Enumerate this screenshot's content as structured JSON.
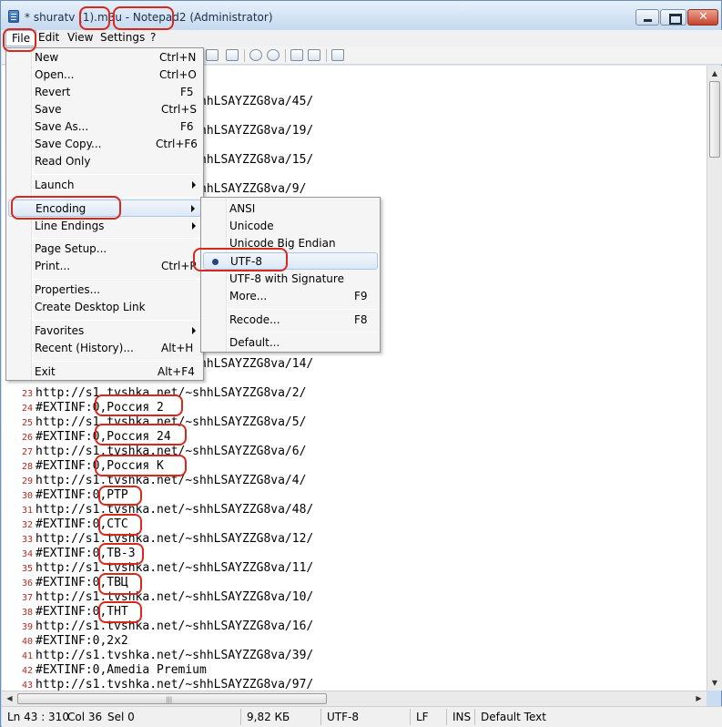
{
  "window": {
    "title": "* shuratv (1).m3u - Notepad2 (Administrator)",
    "accent_color": "#d8281c"
  },
  "menubar": {
    "items": [
      "File",
      "Edit",
      "View",
      "Settings",
      "?"
    ]
  },
  "toolbar": {
    "icons": [
      "new-file-icon",
      "open-icon",
      "save-icon",
      "undo-icon",
      "redo-icon",
      "cut-icon",
      "copy-icon",
      "paste-icon",
      "find-icon",
      "replace-icon",
      "wordwrap-icon",
      "zoom-in-icon",
      "zoom-out-icon",
      "scheme-icon",
      "customize-icon",
      "exit-icon"
    ]
  },
  "file_menu": {
    "items": [
      {
        "label": "New",
        "shortcut": "Ctrl+N"
      },
      {
        "label": "Open...",
        "shortcut": "Ctrl+O"
      },
      {
        "label": "Revert",
        "shortcut": "F5"
      },
      {
        "label": "Save",
        "shortcut": "Ctrl+S"
      },
      {
        "label": "Save As...",
        "shortcut": "F6"
      },
      {
        "label": "Save Copy...",
        "shortcut": "Ctrl+F6"
      },
      {
        "label": "Read Only",
        "shortcut": ""
      },
      {
        "label": "Launch",
        "shortcut": ""
      },
      {
        "label": "Encoding",
        "shortcut": ""
      },
      {
        "label": "Line Endings",
        "shortcut": ""
      },
      {
        "label": "Page Setup...",
        "shortcut": ""
      },
      {
        "label": "Print...",
        "shortcut": "Ctrl+P"
      },
      {
        "label": "Properties...",
        "shortcut": ""
      },
      {
        "label": "Create Desktop Link",
        "shortcut": ""
      },
      {
        "label": "Favorites",
        "shortcut": ""
      },
      {
        "label": "Recent (History)...",
        "shortcut": "Alt+H"
      },
      {
        "label": "Exit",
        "shortcut": "Alt+F4"
      }
    ]
  },
  "encoding_menu": {
    "items": [
      {
        "label": "ANSI",
        "shortcut": ""
      },
      {
        "label": "Unicode",
        "shortcut": ""
      },
      {
        "label": "Unicode Big Endian",
        "shortcut": ""
      },
      {
        "label": "UTF-8",
        "shortcut": "",
        "selected": true
      },
      {
        "label": "UTF-8 with Signature",
        "shortcut": ""
      },
      {
        "label": "More...",
        "shortcut": "F9"
      },
      {
        "label": "Recode...",
        "shortcut": "F8"
      },
      {
        "label": "Default...",
        "shortcut": ""
      }
    ]
  },
  "editor": {
    "lines": [
      {
        "n": "",
        "text": "http://s1.tvshka.net/~shhLSAYZZG8va/45/"
      },
      {
        "n": "",
        "text": "http://s1.tvshka.net/~shhLSAYZZG8va/19/"
      },
      {
        "n": "",
        "text": "http://s1.tvshka.net/~shhLSAYZZG8va/15/"
      },
      {
        "n": "",
        "text": "http://s1.tvshka.net/~shhLSAYZZG8va/9/"
      },
      {
        "n": "",
        "text": "http://s1.tvshka.net/~shhLSAYZZG8va/14/"
      },
      {
        "n": "23",
        "text": "http://s1.tvshka.net/~shhLSAYZZG8va/2/"
      },
      {
        "n": "24",
        "text": "#EXTINF:0,Россия 2"
      },
      {
        "n": "25",
        "text": "http://s1.tvshka.net/~shhLSAYZZG8va/5/"
      },
      {
        "n": "26",
        "text": "#EXTINF:0,Россия 24"
      },
      {
        "n": "27",
        "text": "http://s1.tvshka.net/~shhLSAYZZG8va/6/"
      },
      {
        "n": "28",
        "text": "#EXTINF:0,Россия К"
      },
      {
        "n": "29",
        "text": "http://s1.tvshka.net/~shhLSAYZZG8va/4/"
      },
      {
        "n": "30",
        "text": "#EXTINF:0,РТР"
      },
      {
        "n": "31",
        "text": "http://s1.tvshka.net/~shhLSAYZZG8va/48/"
      },
      {
        "n": "32",
        "text": "#EXTINF:0,СТС"
      },
      {
        "n": "33",
        "text": "http://s1.tvshka.net/~shhLSAYZZG8va/12/"
      },
      {
        "n": "34",
        "text": "#EXTINF:0,ТВ-3"
      },
      {
        "n": "35",
        "text": "http://s1.tvshka.net/~shhLSAYZZG8va/11/"
      },
      {
        "n": "36",
        "text": "#EXTINF:0,ТВЦ"
      },
      {
        "n": "37",
        "text": "http://s1.tvshka.net/~shhLSAYZZG8va/10/"
      },
      {
        "n": "38",
        "text": "#EXTINF:0,ТНТ"
      },
      {
        "n": "39",
        "text": "http://s1.tvshka.net/~shhLSAYZZG8va/16/"
      },
      {
        "n": "40",
        "text": "#EXTINF:0,2x2"
      },
      {
        "n": "41",
        "text": "http://s1.tvshka.net/~shhLSAYZZG8va/39/"
      },
      {
        "n": "42",
        "text": "#EXTINF:0,Amedia Premium"
      },
      {
        "n": "43",
        "text": "http://s1.tvshka.net/~shhLSAYZZG8va/97/"
      }
    ]
  },
  "statusbar": {
    "position": "Ln 43 : 310",
    "column": "Col 36",
    "selection": "Sel 0",
    "size": "9,82 КБ",
    "encoding": "UTF-8",
    "line_ending": "LF",
    "mode": "INS",
    "scheme": "Default Text"
  }
}
